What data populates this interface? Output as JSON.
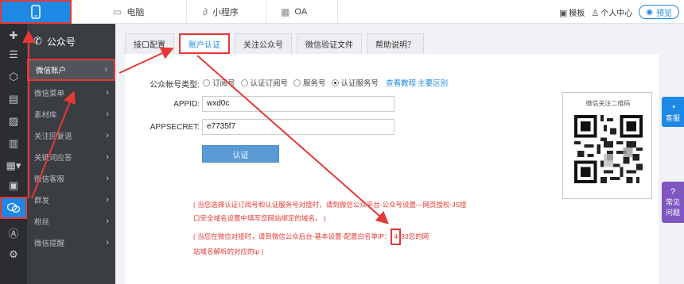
{
  "topbar": {
    "tabs": [
      {
        "label": "电脑",
        "icon": "monitor-icon"
      },
      {
        "label": "小程序",
        "icon": "link-icon"
      },
      {
        "label": "OA",
        "icon": "calendar-icon"
      }
    ],
    "template_label": "模板",
    "user_center_label": "个人中心",
    "preview_label": "预览"
  },
  "subnav": {
    "title": "公众号",
    "items": [
      {
        "label": "微信账户",
        "active": true
      },
      {
        "label": "微信菜单"
      },
      {
        "label": "素材库"
      },
      {
        "label": "关注回复语"
      },
      {
        "label": "关键词应答"
      },
      {
        "label": "微信客服"
      },
      {
        "label": "群发"
      },
      {
        "label": "粉丝"
      },
      {
        "label": "微信提醒"
      }
    ]
  },
  "tabs": [
    {
      "label": "接口配置"
    },
    {
      "label": "账户认证",
      "active": true
    },
    {
      "label": "关注公众号"
    },
    {
      "label": "微信验证文件"
    },
    {
      "label": "帮助说明？"
    }
  ],
  "form": {
    "account_type_label": "公众帐号类型:",
    "account_types": [
      "订阅号",
      "认证订阅号",
      "服务号",
      "认证服务号"
    ],
    "account_type_selected": "认证服务号",
    "help_link": "查看教程",
    "diff_link": "主要区别",
    "appid_label": "APPID:",
    "appid_value": "wxd0c",
    "appsecret_label": "APPSECRET:",
    "appsecret_value": "e7735f7",
    "auth_button": "认证"
  },
  "notes": {
    "line1": "( 当您选择认证订阅号和认证服务号对接时，请到微信公众平台-公众号设置—网页授权-JS接",
    "line2": "口安全域名设置中填写您网站绑定的域名。 )",
    "line3_pre": "( 当您在微信对接时，请到微信公众后台-基本设置-配置白名单IP：",
    "line3_ip": "4",
    "line3_post": "33您的网",
    "line4": "站域名解析的对应的ip )"
  },
  "qr": {
    "title": "微信关注二维码"
  },
  "float_buttons": {
    "customer_service": "客服",
    "faq_line1": "常见",
    "faq_line2": "问题"
  },
  "colors": {
    "brand_blue": "#1e88e5",
    "annotation_red": "#e53935",
    "rail_bg": "#2b2d31",
    "subnav_bg": "#3a3d42"
  }
}
